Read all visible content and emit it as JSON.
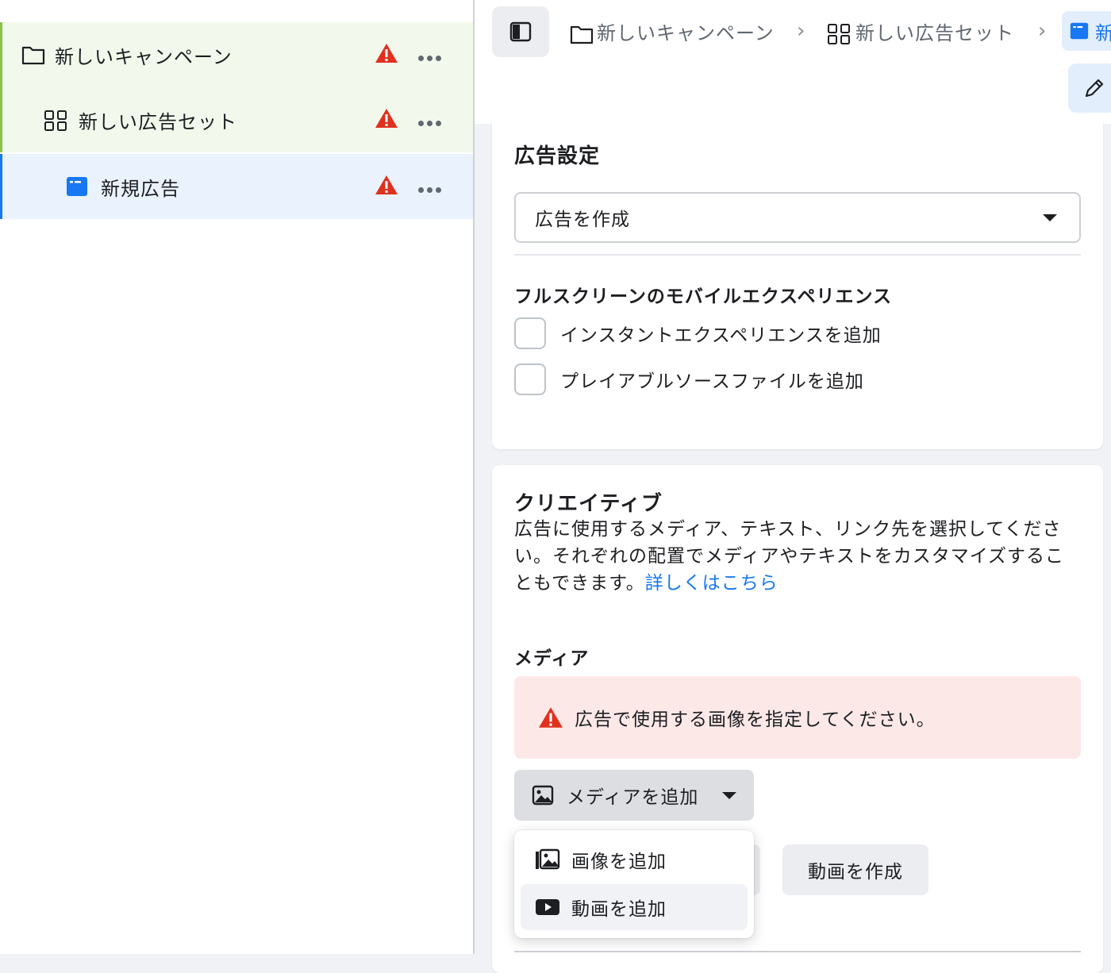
{
  "tree": {
    "items": [
      {
        "label": "新しいキャンペーン",
        "icon": "folder-icon"
      },
      {
        "label": "新しい広告セット",
        "icon": "grid-icon"
      },
      {
        "label": "新規広告",
        "icon": "ad-icon"
      }
    ]
  },
  "breadcrumb": {
    "campaign": "新しいキャンペーン",
    "adset": "新しい広告セット",
    "ad": "新"
  },
  "ad_settings": {
    "title": "広告設定",
    "select_value": "広告を作成",
    "fullscreen_title": "フルスクリーンのモバイルエクスペリエンス",
    "checkbox_instant": "インスタントエクスペリエンスを追加",
    "checkbox_playable": "プレイアブルソースファイルを追加"
  },
  "creative": {
    "title": "クリエイティブ",
    "description": "広告に使用するメディア、テキスト、リンク先を選択してください。それぞれの配置でメディアやテキストをカスタマイズすることもできます。",
    "learn_more": "詳しくはこちら",
    "media_title": "メディア",
    "alert_text": "広告で使用する画像を指定してください。",
    "add_media_label": "メディアを追加",
    "create_video_label": "動画を作成"
  },
  "media_menu": {
    "items": [
      {
        "label": "画像を追加",
        "icon": "image-add-icon"
      },
      {
        "label": "動画を追加",
        "icon": "video-icon"
      }
    ]
  },
  "colors": {
    "accent": "#1877f2",
    "warning": "#e0301e",
    "green_highlight": "#f2f9ec",
    "blue_highlight": "#eaf2fd",
    "alert_bg": "#fde8e8"
  }
}
